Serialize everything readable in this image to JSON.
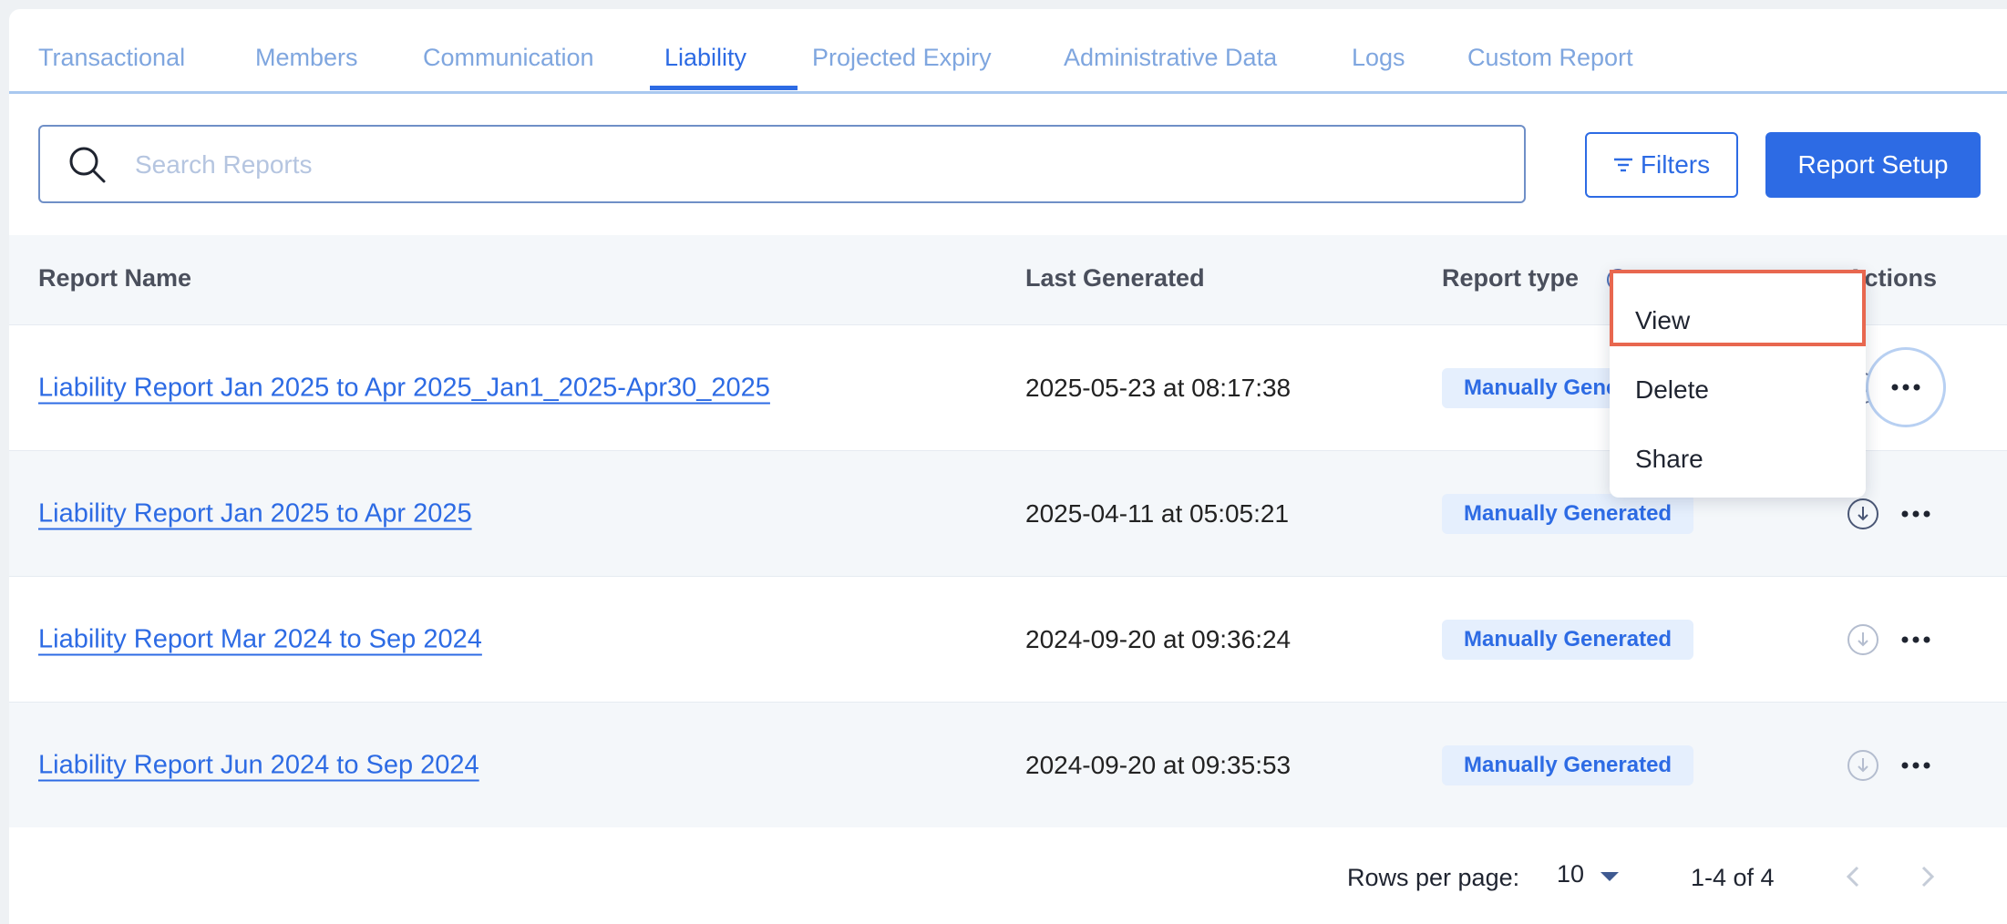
{
  "tabs": [
    {
      "label": "Transactional"
    },
    {
      "label": "Members"
    },
    {
      "label": "Communication"
    },
    {
      "label": "Liability"
    },
    {
      "label": "Projected Expiry"
    },
    {
      "label": "Administrative Data"
    },
    {
      "label": "Logs"
    },
    {
      "label": "Custom Report"
    }
  ],
  "active_tab": "Liability",
  "search": {
    "placeholder": "Search Reports",
    "value": ""
  },
  "toolbar": {
    "filters_label": "Filters",
    "setup_label": "Report Setup"
  },
  "table": {
    "columns": [
      "Report Name",
      "Last Generated",
      "Report type",
      "Actions"
    ],
    "rows": [
      {
        "name": "Liability Report Jan 2025 to Apr 2025_Jan1_2025-Apr30_2025",
        "last_generated": "2025-05-23 at 08:17:38",
        "type": "Manually Generated"
      },
      {
        "name": "Liability Report Jan 2025 to Apr 2025",
        "last_generated": "2025-04-11 at 05:05:21",
        "type": "Manually Generated"
      },
      {
        "name": "Liability Report Mar 2024 to Sep 2024",
        "last_generated": "2024-09-20 at 09:36:24",
        "type": "Manually Generated"
      },
      {
        "name": "Liability Report Jun 2024 to Sep 2024",
        "last_generated": "2024-09-20 at 09:35:53",
        "type": "Manually Generated"
      }
    ]
  },
  "actions_menu": {
    "items": [
      "View",
      "Delete",
      "Share"
    ],
    "highlighted": "View"
  },
  "pagination": {
    "rows_per_page_label": "Rows per page:",
    "rows_per_page": "10",
    "range": "1-4 of 4"
  },
  "colors": {
    "accent": "#2d6be4",
    "badge_bg": "#e5effd",
    "highlight_border": "#e8674f"
  }
}
